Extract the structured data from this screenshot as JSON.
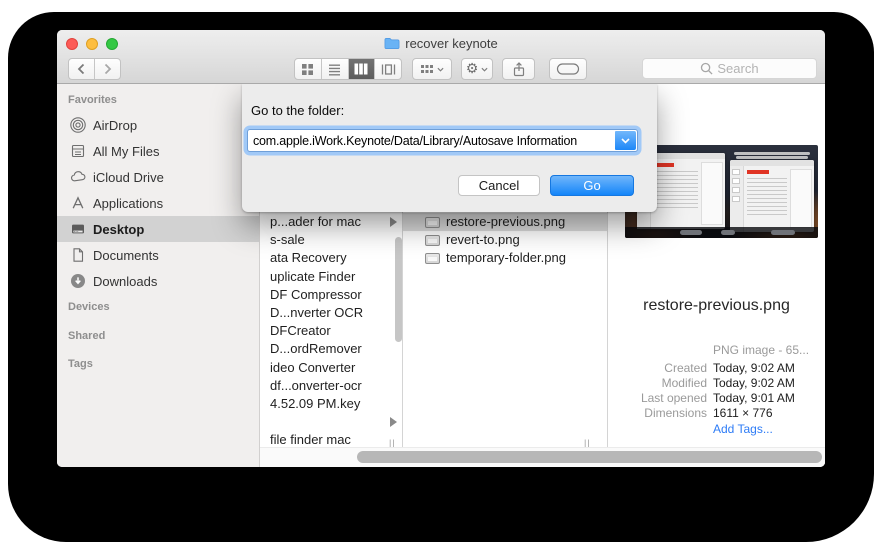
{
  "window": {
    "title": "recover keynote"
  },
  "toolbar": {
    "search_placeholder": "Search"
  },
  "sidebar": {
    "headers": {
      "favorites": "Favorites",
      "devices": "Devices",
      "shared": "Shared",
      "tags": "Tags"
    },
    "items": [
      "AirDrop",
      "All My Files",
      "iCloud Drive",
      "Applications",
      "Desktop",
      "Documents",
      "Downloads"
    ],
    "selected_item": "Desktop"
  },
  "dialog": {
    "title": "Go to the folder:",
    "path": "com.apple.iWork.Keynote/Data/Library/Autosave Information",
    "cancel_label": "Cancel",
    "go_label": "Go"
  },
  "files": {
    "column1": [
      "p...ader for mac",
      "s-sale",
      "ata Recovery",
      "uplicate Finder",
      "DF Compressor",
      "D...nverter OCR",
      "DFCreator",
      "D...ordRemover",
      "ideo Converter",
      "df...onverter-ocr",
      "4.52.09 PM.key",
      "",
      "file finder mac"
    ],
    "column2": [
      "restore-previous.png",
      "revert-to.png",
      "temporary-folder.png"
    ],
    "selected_file": "restore-previous.png"
  },
  "preview": {
    "filename": "restore-previous.png",
    "kind": "PNG image - 65...",
    "rows": [
      {
        "label": "Created",
        "value": "Today, 9:02 AM"
      },
      {
        "label": "Modified",
        "value": "Today, 9:02 AM"
      },
      {
        "label": "Last opened",
        "value": "Today, 9:01 AM"
      },
      {
        "label": "Dimensions",
        "value": "1611 × 776"
      }
    ],
    "add_tags_label": "Add Tags..."
  },
  "icons": {
    "title_folder": "blue-folder",
    "back": "chevron-left",
    "forward": "chevron-right",
    "view_modes": [
      "grid",
      "list",
      "columns",
      "coverflow"
    ],
    "arrange": "grid-menu",
    "action": "gear",
    "share": "share-arrow",
    "tags": "tag-capsule",
    "search": "magnifier",
    "disclosure": "triangle-right"
  },
  "colors": {
    "go_button_blue": "#1485f9",
    "focus_ring_blue": "#70b2ff",
    "link_blue": "#2e7cf6",
    "sidebar_selection_gray": "#d2d2d2",
    "chrome_gradient_top": "#eeeeee",
    "chrome_gradient_bottom": "#d6d6d6"
  }
}
